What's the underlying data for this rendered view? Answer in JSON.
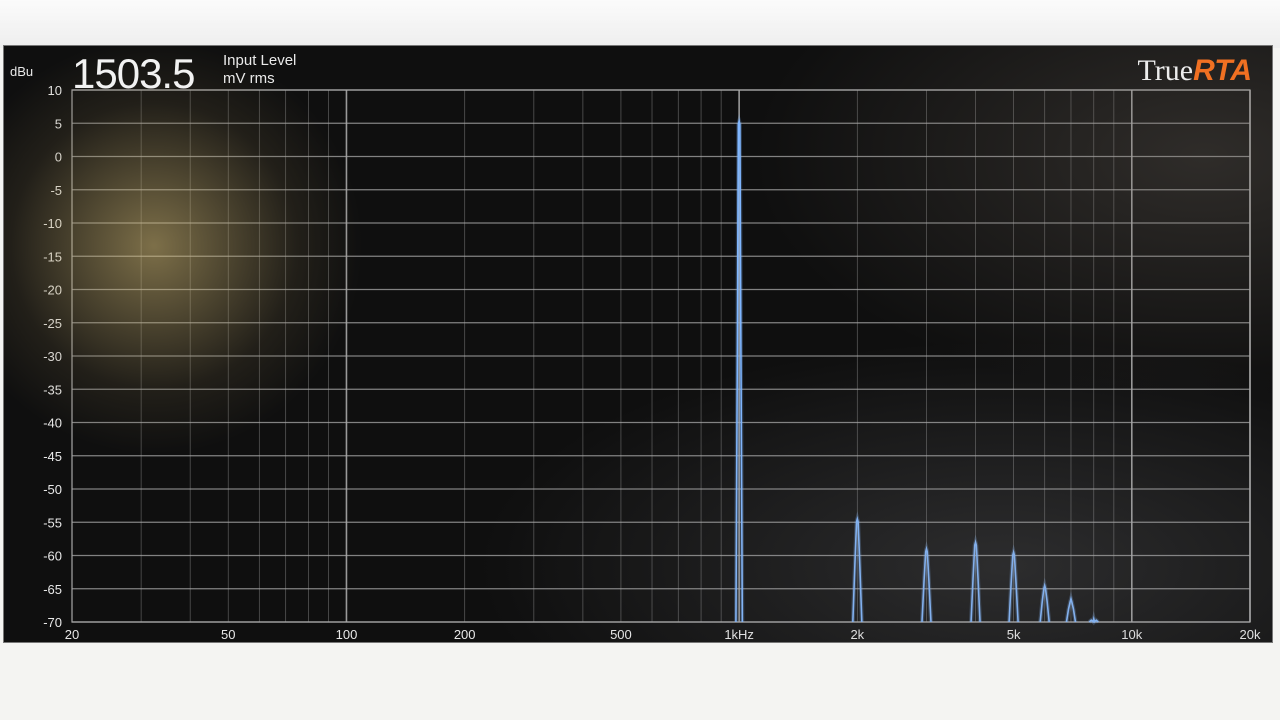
{
  "app": {
    "brand_true": "True",
    "brand_rta": "RTA"
  },
  "readout": {
    "value": "1503.5",
    "caption_line1": "Input Level",
    "caption_line2": "mV rms"
  },
  "chart_data": {
    "type": "line",
    "x_scale": "log",
    "xlim": [
      20,
      20000
    ],
    "ylim": [
      -70,
      10
    ],
    "ylabel": "dBu",
    "y_ticks": [
      "10",
      "5",
      "0",
      "-5",
      "-10",
      "-15",
      "-20",
      "-25",
      "-30",
      "-35",
      "-40",
      "-45",
      "-50",
      "-55",
      "-60",
      "-65",
      "-70"
    ],
    "x_ticks": [
      {
        "value": 20,
        "label": "20"
      },
      {
        "value": 50,
        "label": "50"
      },
      {
        "value": 100,
        "label": "100"
      },
      {
        "value": 200,
        "label": "200"
      },
      {
        "value": 500,
        "label": "500"
      },
      {
        "value": 1000,
        "label": "1kHz"
      },
      {
        "value": 2000,
        "label": "2k"
      },
      {
        "value": 5000,
        "label": "5k"
      },
      {
        "value": 10000,
        "label": "10k"
      },
      {
        "value": 20000,
        "label": "20k"
      }
    ],
    "grid": true,
    "colors": {
      "trace": "#7fb6ff",
      "grid": "#a9a9a9",
      "accent": "#f07022"
    },
    "series": [
      {
        "peaks": [
          {
            "freq": 1000,
            "dbu": 5.3
          },
          {
            "freq": 2000,
            "dbu": -54.5
          },
          {
            "freq": 3000,
            "dbu": -59
          },
          {
            "freq": 4000,
            "dbu": -58
          },
          {
            "freq": 5000,
            "dbu": -59.5
          },
          {
            "freq": 6000,
            "dbu": -64.5
          },
          {
            "freq": 7000,
            "dbu": -66.5
          },
          {
            "freq": 8000,
            "dbu": -69.5
          }
        ]
      }
    ]
  }
}
